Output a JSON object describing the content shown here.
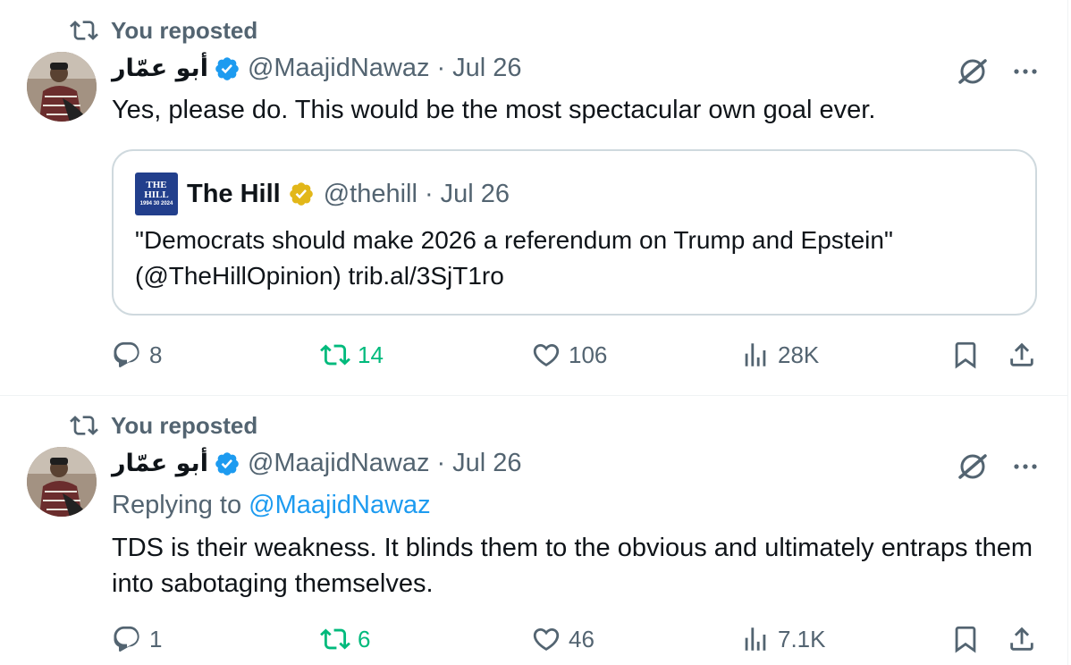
{
  "posts": [
    {
      "repost_label": "You reposted",
      "author_name": "أبو عمّار",
      "handle": "@MaajidNawaz",
      "separator": "·",
      "date": "Jul 26",
      "text": "Yes, please do. This would be the most spectacular own goal ever.",
      "quote": {
        "logo_lines": [
          "THE",
          "HILL",
          "1994 30 2024"
        ],
        "name": "The Hill",
        "handle": "@thehill",
        "separator": "·",
        "date": "Jul 26",
        "text_line1": "\"Democrats should make 2026 a referendum on Trump and Epstein\"",
        "text_line2": "(@TheHillOpinion) trib.al/3SjT1ro"
      },
      "stats": {
        "replies": "8",
        "reposts": "14",
        "likes": "106",
        "views": "28K"
      }
    },
    {
      "repost_label": "You reposted",
      "author_name": "أبو عمّار",
      "handle": "@MaajidNawaz",
      "separator": "·",
      "date": "Jul 26",
      "replying_prefix": "Replying to",
      "replying_to": "@MaajidNawaz",
      "text": "TDS is their weakness. It blinds them to the obvious and ultimately entraps them into sabotaging themselves.",
      "stats": {
        "replies": "1",
        "reposts": "6",
        "likes": "46",
        "views": "7.1K"
      }
    }
  ],
  "icons": {
    "repost": "repost-icon",
    "verified": "verified-badge-icon",
    "grok": "grok-icon",
    "more": "more-icon",
    "reply": "reply-icon",
    "like": "heart-icon",
    "views": "views-icon",
    "bookmark": "bookmark-icon",
    "share": "share-icon"
  },
  "colors": {
    "text": "#0f1419",
    "muted": "#536471",
    "link": "#1d9bf0",
    "repost_green": "#00ba7c",
    "verified_blue": "#1d9bf0",
    "verified_gold": "#e2b719",
    "hill_blue": "#223f8c"
  }
}
